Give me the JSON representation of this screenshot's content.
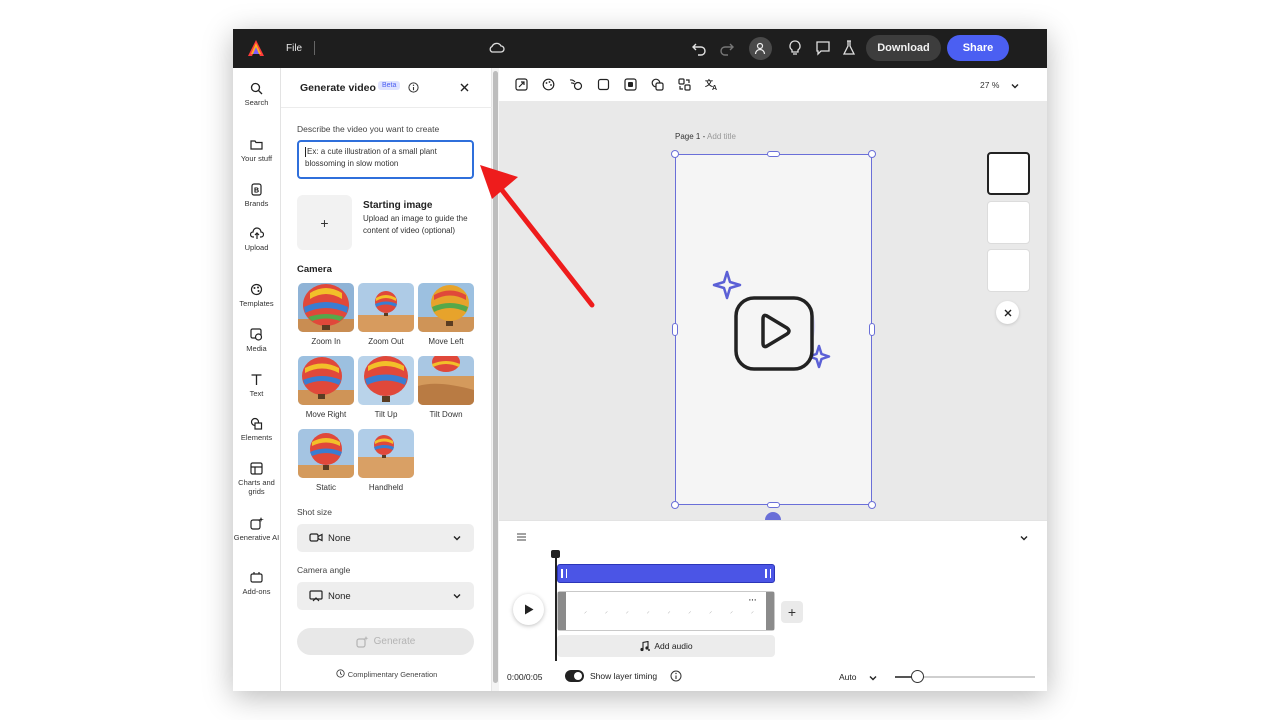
{
  "topbar": {
    "file_label": "File",
    "download_label": "Download",
    "share_label": "Share"
  },
  "rail": {
    "items": [
      {
        "label": "Search",
        "icon": "search-icon"
      },
      {
        "label": "Your stuff",
        "icon": "folder-icon"
      },
      {
        "label": "Brands",
        "icon": "brand-icon"
      },
      {
        "label": "Upload",
        "icon": "upload-icon"
      },
      {
        "label": "Templates",
        "icon": "templates-icon"
      },
      {
        "label": "Media",
        "icon": "media-icon"
      },
      {
        "label": "Text",
        "icon": "text-icon"
      },
      {
        "label": "Elements",
        "icon": "elements-icon"
      },
      {
        "label": "Charts and grids",
        "icon": "charts-icon"
      },
      {
        "label": "Generative AI",
        "icon": "generative-ai-icon"
      },
      {
        "label": "Add-ons",
        "icon": "add-ons-icon"
      }
    ]
  },
  "panel": {
    "title": "Generate video",
    "badge": "Beta",
    "describe_label": "Describe the video you want to create",
    "prompt_placeholder": "Ex: a cute illustration of a small plant blossoming in slow motion",
    "starting_image": {
      "title": "Starting image",
      "description": "Upload an image to guide the content of video (optional)",
      "add_symbol": "+"
    },
    "camera_heading": "Camera",
    "camera_options": [
      "Zoom In",
      "Zoom Out",
      "Move Left",
      "Move Right",
      "Tilt Up",
      "Tilt Down",
      "Static",
      "Handheld"
    ],
    "shot_size": {
      "label": "Shot size",
      "value": "None"
    },
    "camera_angle": {
      "label": "Camera angle",
      "value": "None"
    },
    "generate_label": "Generate",
    "complimentary_label": "Complimentary Generation"
  },
  "canvas": {
    "zoom": "27 %",
    "page_label": "Page 1 - ",
    "page_title_placeholder": "Add title"
  },
  "timeline": {
    "time": "0:00/0:05",
    "add_audio_label": "Add audio",
    "show_layer_timing_label": "Show layer timing",
    "auto_label": "Auto",
    "add_symbol": "+",
    "more_symbol": "···"
  },
  "colors": {
    "accent": "#4b5ff2",
    "topbar": "#1e1e1e",
    "selection": "#6a6fd8",
    "annotation_arrow": "#ee1c1c"
  }
}
